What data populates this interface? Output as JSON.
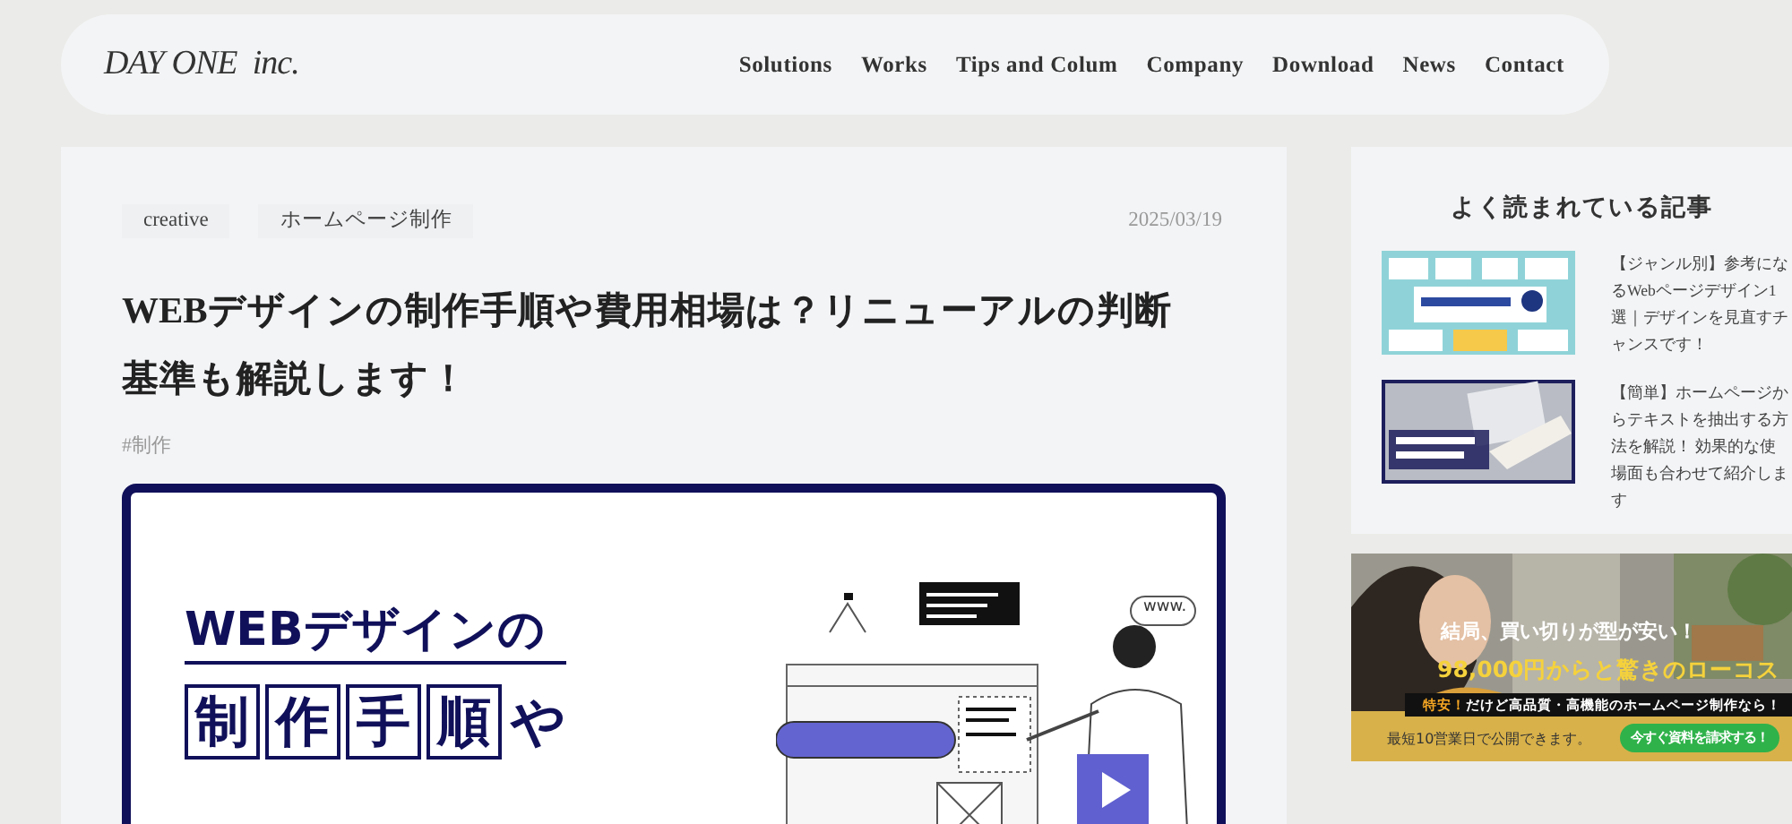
{
  "header": {
    "logo": "DAY ONE  inc.",
    "nav": [
      {
        "label": "Solutions"
      },
      {
        "label": "Works"
      },
      {
        "label": "Tips and Colum"
      },
      {
        "label": "Company"
      },
      {
        "label": "Download"
      },
      {
        "label": "News"
      },
      {
        "label": "Contact"
      }
    ]
  },
  "article": {
    "categories": [
      "creative",
      "ホームページ制作"
    ],
    "date": "2025/03/19",
    "title": "WEBデザインの制作手順や費用相場は？リニューアルの判断基準も解説します！",
    "tags": [
      "#制作"
    ],
    "hero": {
      "line_1": "WEBデザインの",
      "line_2_boxed": [
        "制",
        "作",
        "手",
        "順"
      ],
      "line_2_tail": "や",
      "bubble": "www."
    }
  },
  "sidebar": {
    "title": "よく読まれている記事",
    "articles": [
      {
        "lines": [
          "【ジャンル別】参考にな",
          "るWebページデザイン1",
          "選｜デザインを見直すチ",
          "ャンスです！"
        ]
      },
      {
        "lines": [
          "【簡単】ホームページか",
          "らテキストを抽出する方",
          "法を解説！ 効果的な使",
          "場面も合わせて紹介しま",
          "す"
        ]
      }
    ]
  },
  "ad": {
    "headline": "結局、買い切りが型が安い！",
    "price": "98,000円からと驚きのローコス",
    "strip_accent": "特安！",
    "strip": "だけど高品質・高機能のホームページ制作なら！",
    "note": "最短10営業日で公開できます。",
    "cta": "今すぐ資料を請求する！"
  }
}
